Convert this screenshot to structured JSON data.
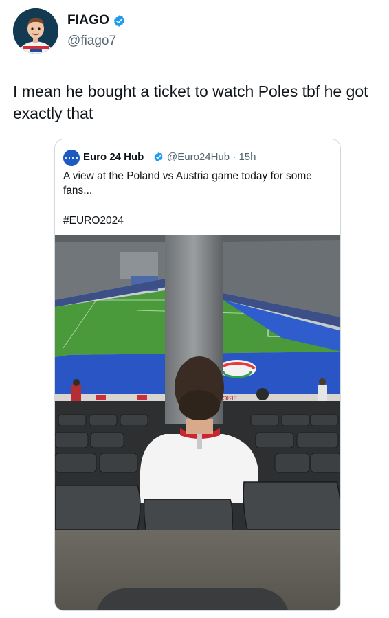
{
  "author": {
    "name": "FIAGO",
    "handle": "@fiago7",
    "verified_icon": "verified-badge-icon",
    "avatar_icon": "avatar"
  },
  "tweet": {
    "text": "I mean he bought a ticket to watch Poles tbf he got exactly that"
  },
  "quote": {
    "name": "Euro 24 Hub",
    "handle_time": "@Euro24Hub · 15h",
    "text": "A view at the Poland vs Austria game today for some fans...",
    "hashtag": "#EURO2024",
    "accent_color": "#1d9bf0"
  },
  "photo": {
    "description_icon": "stadium-photo",
    "signage": "ЭIЯЕ"
  }
}
